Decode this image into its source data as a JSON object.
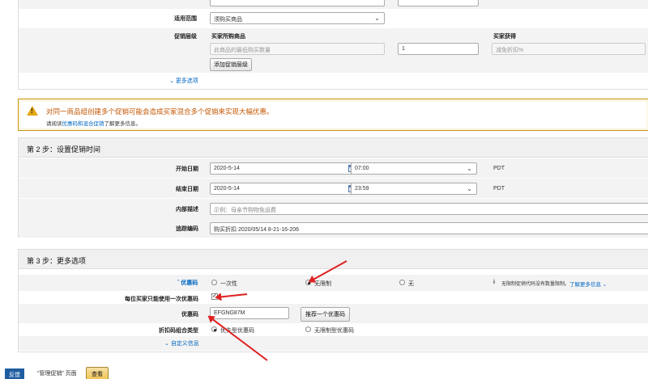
{
  "top_panel": {
    "scope_label": "适用范围",
    "scope_value": "须购买商品",
    "tiers_label": "促销层级",
    "buyer_purchases_header": "买家所购商品",
    "buyer_gets_header": "买家获得",
    "min_qty_placeholder": "此商品的最低购买数量",
    "qty_value": "1",
    "discount_placeholder": "减免折扣%",
    "add_tier_button": "添加促销层级",
    "more_options_link": "更多选项"
  },
  "warning": {
    "title": "对同一商品组创建多个促销可能会造成买家混合多个促销来实现大幅优惠。",
    "body_prefix": "请阅读",
    "body_link": "优惠码和混合促销",
    "body_suffix": "了解更多信息。"
  },
  "step2": {
    "header": "第 2 步：设置促销时间",
    "start_label": "开始日期",
    "start_date": "2020-5-14",
    "start_time": "07:00",
    "end_label": "结束日期",
    "end_date": "2020-5-14",
    "end_time": "23:59",
    "tz": "PDT",
    "desc_label": "内部描述",
    "desc_placeholder": "示例：母亲节购物免运费",
    "tracking_label": "追踪编码",
    "tracking_value": "购买折扣 2020/05/14 8-21-16-206"
  },
  "step3": {
    "header": "第 3 步：更多选项",
    "coupon_label": "优惠码",
    "opt_once": "一次性",
    "opt_unlimited": "无限制",
    "opt_none": "无",
    "info_text": "无限制促销代码没有数量限制。",
    "learn_more": "了解更多信息",
    "once_per_buyer_label": "每位买家只能使用一次优惠码",
    "code_label": "优惠码",
    "code_value": "EFGNG87M",
    "suggest_button": "推荐一个优惠码",
    "combo_label": "折扣码组合类型",
    "combo_opt1": "优先型优惠码",
    "combo_opt2": "无限制型优惠码",
    "custom_link": "自定义信息"
  },
  "bottom": {
    "feedback_label": "反馈",
    "manage_text": "“管理促销” 页面",
    "view_button": "查看"
  },
  "colors": {
    "accent": "#0066c0",
    "warning_border": "#c89411",
    "arrow": "#e02020"
  },
  "icons": [
    "warning-icon",
    "calendar-icon",
    "chevron-down-icon",
    "chevron-up-icon",
    "info-icon"
  ]
}
